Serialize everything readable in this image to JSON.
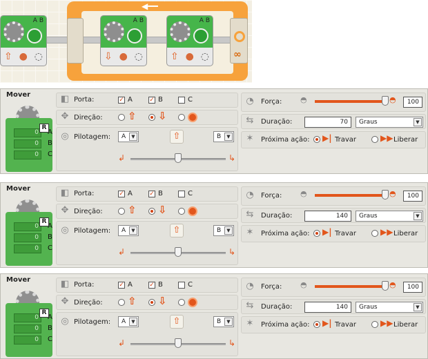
{
  "program": {
    "blocks": [
      {
        "ports": "A B"
      },
      {
        "ports": "A B"
      },
      {
        "ports": "A B"
      }
    ]
  },
  "panels": [
    {
      "title": "Mover",
      "ports_label": "Porta:",
      "port_a": "A",
      "port_b": "B",
      "port_c": "C",
      "port_a_checked": true,
      "port_b_checked": true,
      "port_c_checked": false,
      "direction_label": "Direção:",
      "direction_selected": "down",
      "steering_label": "Pilotagem:",
      "steer_left_port": "A",
      "steer_right_port": "B",
      "steer_value": 0.5,
      "power_label": "Força:",
      "power_value": "100",
      "duration_label": "Duração:",
      "duration_value": "70",
      "duration_unit": "Graus",
      "next_label": "Próxima ação:",
      "next_brake": "Travar",
      "next_coast": "Liberar",
      "next_selected": "brake",
      "readouts": [
        "0",
        "0",
        "0"
      ],
      "readout_labels": [
        "A",
        "B",
        "C"
      ],
      "reset": "R"
    },
    {
      "title": "Mover",
      "ports_label": "Porta:",
      "port_a": "A",
      "port_b": "B",
      "port_c": "C",
      "port_a_checked": true,
      "port_b_checked": true,
      "port_c_checked": false,
      "direction_label": "Direção:",
      "direction_selected": "down",
      "steering_label": "Pilotagem:",
      "steer_left_port": "A",
      "steer_right_port": "B",
      "steer_value": 0.5,
      "power_label": "Força:",
      "power_value": "100",
      "duration_label": "Duração:",
      "duration_value": "140",
      "duration_unit": "Graus",
      "next_label": "Próxima ação:",
      "next_brake": "Travar",
      "next_coast": "Liberar",
      "next_selected": "brake",
      "readouts": [
        "0",
        "0",
        "0"
      ],
      "readout_labels": [
        "A",
        "B",
        "C"
      ],
      "reset": "R"
    },
    {
      "title": "Mover",
      "ports_label": "Porta:",
      "port_a": "A",
      "port_b": "B",
      "port_c": "C",
      "port_a_checked": true,
      "port_b_checked": true,
      "port_c_checked": false,
      "direction_label": "Direção:",
      "direction_selected": "down",
      "steering_label": "Pilotagem:",
      "steer_left_port": "A",
      "steer_right_port": "B",
      "steer_value": 0.5,
      "power_label": "Força:",
      "power_value": "100",
      "duration_label": "Duração:",
      "duration_value": "140",
      "duration_unit": "Graus",
      "next_label": "Próxima ação:",
      "next_brake": "Travar",
      "next_coast": "Liberar",
      "next_selected": "brake",
      "readouts": [
        "0",
        "0",
        "0"
      ],
      "readout_labels": [
        "A",
        "B",
        "C"
      ],
      "reset": "R"
    }
  ],
  "icons": {
    "gear": "gear-icon",
    "port": "port-icon",
    "compass": "compass-icon",
    "steering": "steering-wheel-icon",
    "power": "power-icon",
    "duration": "duration-icon",
    "next": "next-action-icon"
  },
  "colors": {
    "accent": "#e2561c",
    "block_green": "#53b34f",
    "loop_orange": "#f7a23c"
  }
}
